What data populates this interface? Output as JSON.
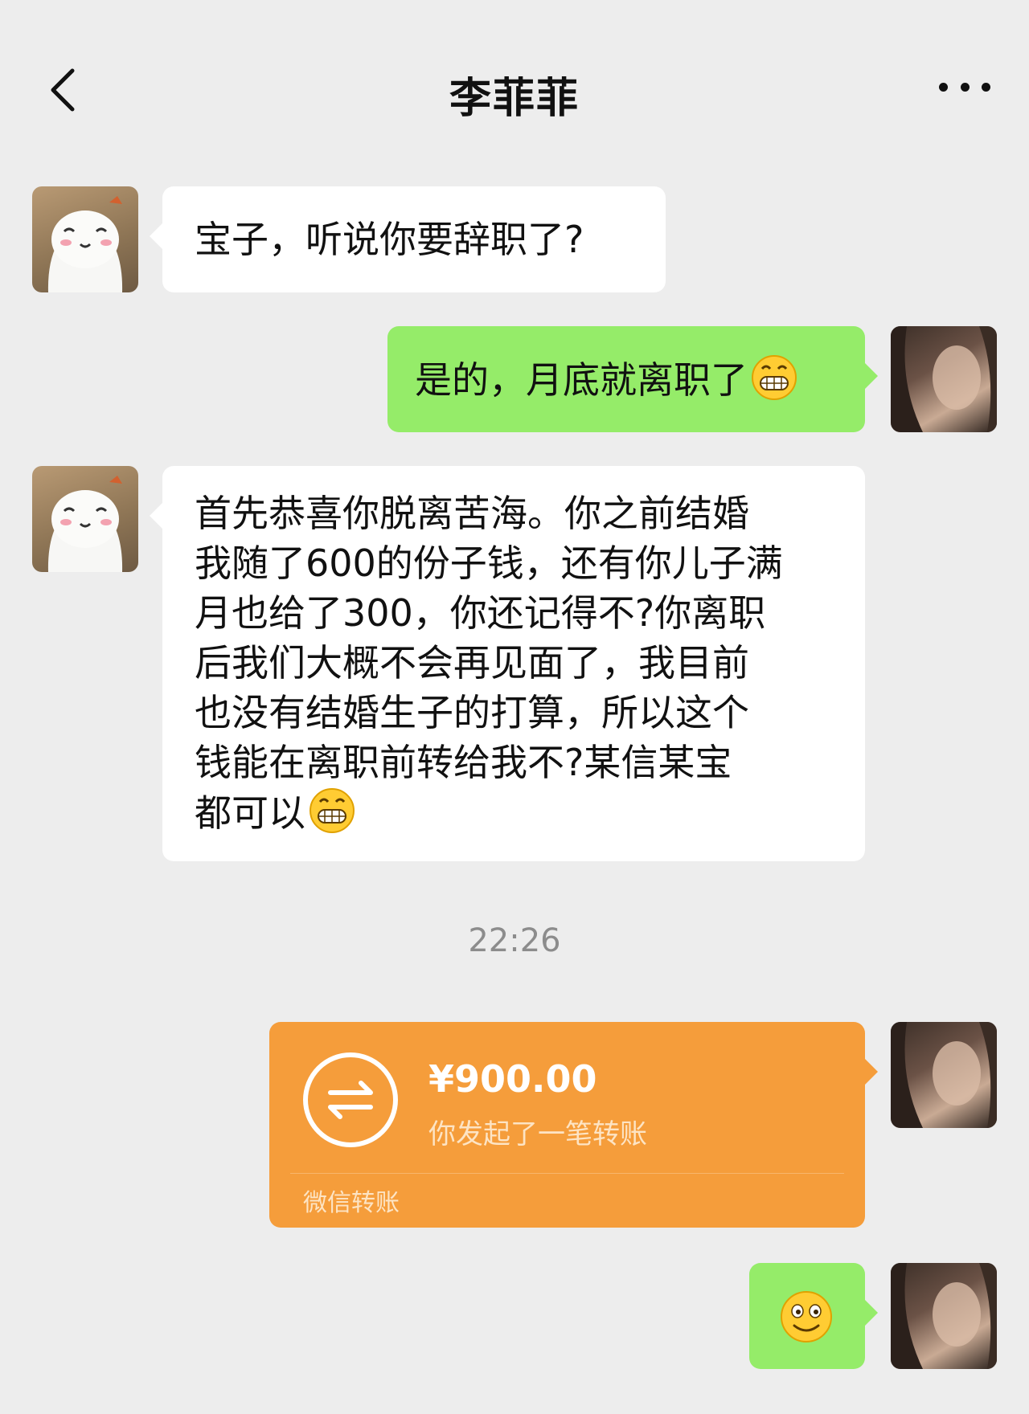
{
  "header": {
    "title": "李菲菲"
  },
  "messages": {
    "m1": "宝子，听说你要辞职了?",
    "m2": "是的，月底就离职了",
    "m3_lines": [
      "首先恭喜你脱离苦海。你之前结婚",
      "我随了600的份子钱，还有你儿子满",
      "月也给了300，你还记得不?你离职",
      "后我们大概不会再见面了，我目前",
      "也没有结婚生子的打算，所以这个",
      "钱能在离职前转给我不?某信某宝",
      "都可以"
    ]
  },
  "timestamp": "22:26",
  "transfer": {
    "amount": "¥900.00",
    "desc": "你发起了一笔转账",
    "footer": "微信转账"
  },
  "icons": {
    "back": "chevron-left-icon",
    "more": "more-dots-icon",
    "grin": "grinning-emoji",
    "smile": "smile-emoji",
    "transfer": "transfer-arrows-icon"
  },
  "colors": {
    "background": "#ededed",
    "sent_bubble": "#95ec69",
    "received_bubble": "#ffffff",
    "transfer_card": "#f59d3b"
  }
}
